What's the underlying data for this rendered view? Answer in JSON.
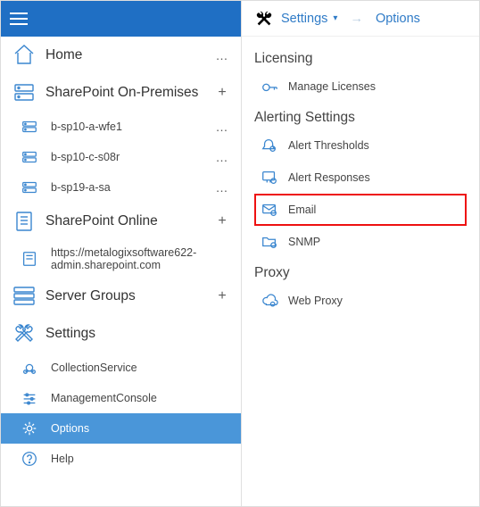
{
  "breadcrumb": {
    "root": "Settings",
    "leaf": "Options"
  },
  "sidebar": {
    "sections": [
      {
        "kind": "section",
        "label": "Home",
        "icon": "home",
        "action": "dots"
      },
      {
        "kind": "section",
        "label": "SharePoint On-Premises",
        "icon": "sp-onprem",
        "action": "plus"
      },
      {
        "kind": "sub",
        "label": "b-sp10-a-wfe1",
        "icon": "server",
        "action": "dots"
      },
      {
        "kind": "sub",
        "label": "b-sp10-c-s08r",
        "icon": "server",
        "action": "dots"
      },
      {
        "kind": "sub",
        "label": "b-sp19-a-sa",
        "icon": "server",
        "action": "dots"
      },
      {
        "kind": "section",
        "label": "SharePoint Online",
        "icon": "sp-online",
        "action": "plus"
      },
      {
        "kind": "sub",
        "label": "https://metalogixsoftware622-admin.sharepoint.com",
        "icon": "site",
        "action": ""
      },
      {
        "kind": "section",
        "label": "Server Groups",
        "icon": "server-groups",
        "action": "plus"
      },
      {
        "kind": "section",
        "label": "Settings",
        "icon": "wrench",
        "action": ""
      },
      {
        "kind": "sub",
        "label": "CollectionService",
        "icon": "collection",
        "action": ""
      },
      {
        "kind": "sub",
        "label": "ManagementConsole",
        "icon": "sliders",
        "action": ""
      },
      {
        "kind": "sub",
        "label": "Options",
        "icon": "gear",
        "action": "",
        "selected": true
      },
      {
        "kind": "sub",
        "label": "Help",
        "icon": "help",
        "action": ""
      }
    ]
  },
  "panel": {
    "groups": [
      {
        "title": "Licensing",
        "items": [
          {
            "label": "Manage Licenses",
            "icon": "key"
          }
        ]
      },
      {
        "title": "Alerting Settings",
        "items": [
          {
            "label": "Alert Thresholds",
            "icon": "bell-gear"
          },
          {
            "label": "Alert Responses",
            "icon": "monitor-gear"
          },
          {
            "label": "Email",
            "icon": "mail-gear",
            "highlight": true
          },
          {
            "label": "SNMP",
            "icon": "folder-gear"
          }
        ]
      },
      {
        "title": "Proxy",
        "items": [
          {
            "label": "Web Proxy",
            "icon": "cloud-gear"
          }
        ]
      }
    ]
  }
}
